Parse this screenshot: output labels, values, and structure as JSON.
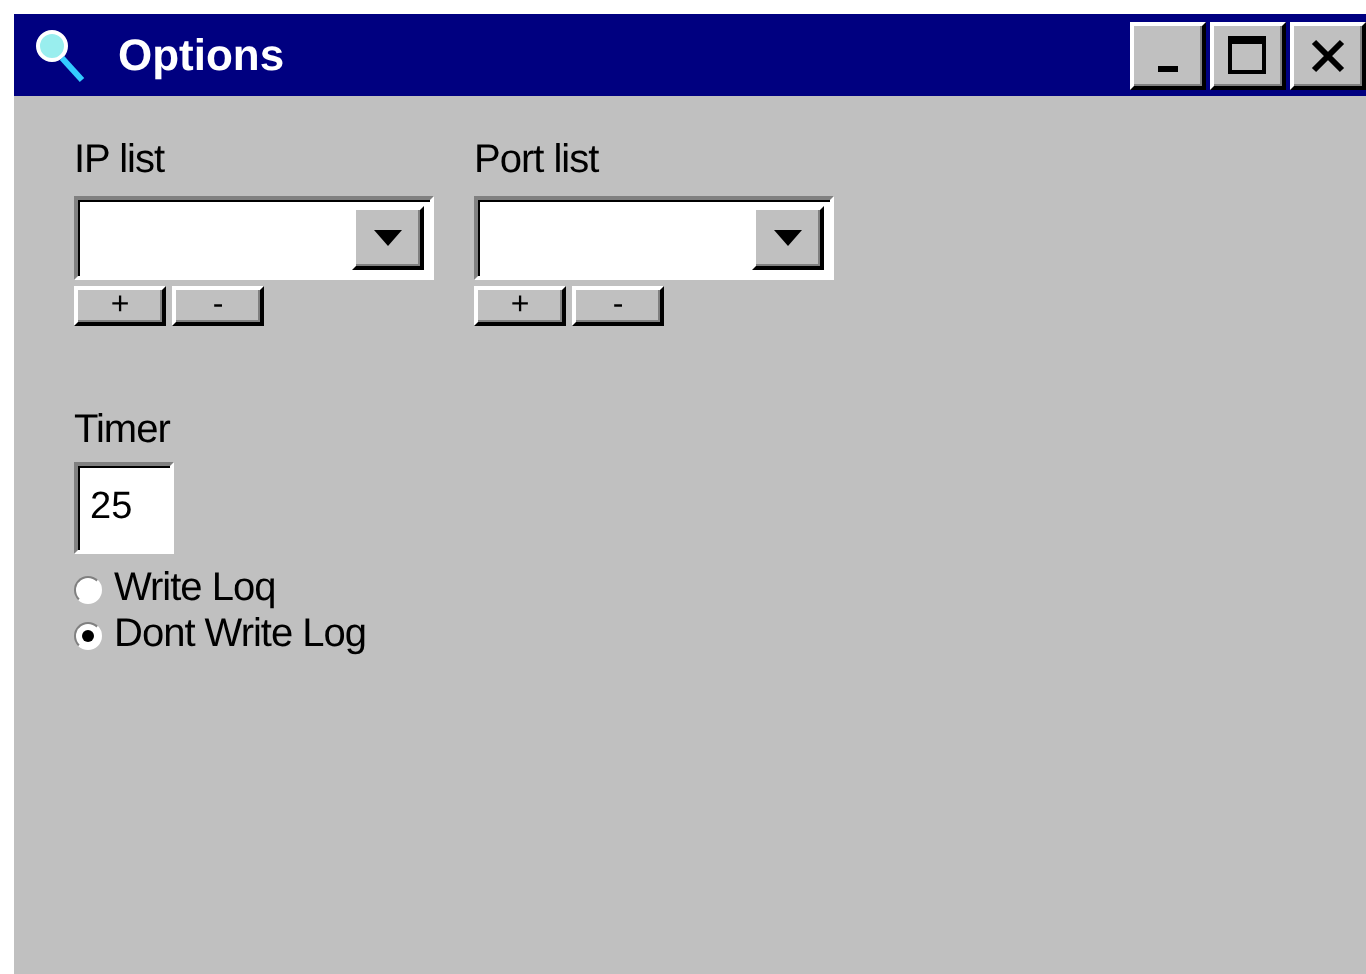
{
  "window": {
    "title": "Options"
  },
  "lists": [
    {
      "label": "IP list",
      "buttons": [
        "+",
        "-"
      ]
    },
    {
      "label": "Port list",
      "buttons": [
        "+",
        "-"
      ]
    }
  ],
  "timer": {
    "label": "Timer",
    "value": "25"
  },
  "log_options": [
    {
      "label": "Write Loq",
      "selected": false
    },
    {
      "label": "Dont Write Log",
      "selected": true
    }
  ]
}
